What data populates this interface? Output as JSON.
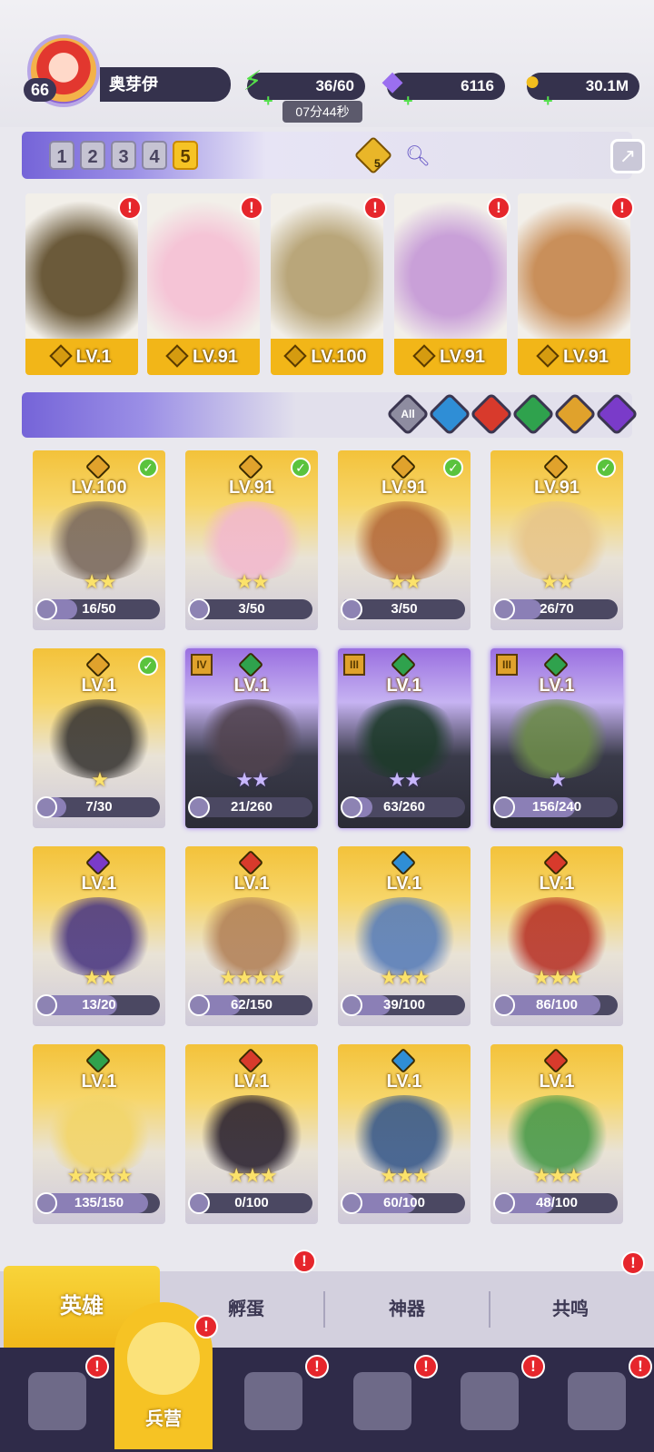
{
  "player": {
    "level": "66",
    "name": "奥芽伊"
  },
  "resources": {
    "energy": {
      "value": "36/60",
      "timer": "07分44秒",
      "icon": "lightning-icon"
    },
    "gems": {
      "value": "6116",
      "icon": "gem-icon"
    },
    "gold": {
      "value": "30.1M",
      "icon": "coin-icon"
    }
  },
  "team": {
    "slots": [
      "1",
      "2",
      "3",
      "4",
      "5"
    ],
    "active_slot": "5",
    "diamond_count": "5"
  },
  "lineup": [
    {
      "level": "LV.1",
      "color": "#6b5a3a"
    },
    {
      "level": "LV.91",
      "color": "#f5c4d6"
    },
    {
      "level": "LV.100",
      "color": "#b9a67a"
    },
    {
      "level": "LV.91",
      "color": "#c9a0d8"
    },
    {
      "level": "LV.91",
      "color": "#c98f5a"
    }
  ],
  "filters": [
    {
      "label": "All",
      "color": "#8e8ca0"
    },
    {
      "label": "",
      "color": "#2f8ed6"
    },
    {
      "label": "",
      "color": "#d83a2c"
    },
    {
      "label": "",
      "color": "#2fa24d"
    },
    {
      "label": "",
      "color": "#e0a22c"
    },
    {
      "label": "",
      "color": "#7a3bc9"
    }
  ],
  "heroes": [
    {
      "level": "LV.100",
      "progress": "16/50",
      "fraction": 0.32,
      "stars": "★★",
      "element": "#e0a22c",
      "owned": true,
      "rank": "",
      "purple": false,
      "art": "#7b6a5e"
    },
    {
      "level": "LV.91",
      "progress": "3/50",
      "fraction": 0.06,
      "stars": "★★",
      "element": "#e0a22c",
      "owned": true,
      "rank": "",
      "purple": false,
      "art": "#f2b9cd"
    },
    {
      "level": "LV.91",
      "progress": "3/50",
      "fraction": 0.06,
      "stars": "★★",
      "element": "#e0a22c",
      "owned": true,
      "rank": "",
      "purple": false,
      "art": "#b56b3a"
    },
    {
      "level": "LV.91",
      "progress": "26/70",
      "fraction": 0.37,
      "stars": "★★",
      "element": "#e0a22c",
      "owned": true,
      "rank": "",
      "purple": false,
      "art": "#e7c58a"
    },
    {
      "level": "LV.1",
      "progress": "7/30",
      "fraction": 0.23,
      "stars": "★",
      "element": "#e0a22c",
      "owned": true,
      "rank": "",
      "purple": false,
      "art": "#3b3835"
    },
    {
      "level": "LV.1",
      "progress": "21/260",
      "fraction": 0.08,
      "stars": "★★",
      "element": "#2fa24d",
      "owned": false,
      "rank": "IV",
      "purple": true,
      "art": "#51434f"
    },
    {
      "level": "LV.1",
      "progress": "63/260",
      "fraction": 0.24,
      "stars": "★★",
      "element": "#2fa24d",
      "owned": false,
      "rank": "III",
      "purple": true,
      "art": "#1d3a2a"
    },
    {
      "level": "LV.1",
      "progress": "156/240",
      "fraction": 0.65,
      "stars": "★",
      "element": "#2fa24d",
      "owned": false,
      "rank": "III",
      "purple": true,
      "art": "#6c8a4a"
    },
    {
      "level": "LV.1",
      "progress": "13/20",
      "fraction": 0.65,
      "stars": "★★",
      "element": "#7a3bc9",
      "owned": false,
      "rank": "",
      "purple": false,
      "art": "#4d3a82"
    },
    {
      "level": "LV.1",
      "progress": "62/150",
      "fraction": 0.41,
      "stars": "★★★★",
      "element": "#d83a2c",
      "owned": false,
      "rank": "",
      "purple": false,
      "art": "#b3835a"
    },
    {
      "level": "LV.1",
      "progress": "39/100",
      "fraction": 0.39,
      "stars": "★★★",
      "element": "#2f8ed6",
      "owned": false,
      "rank": "",
      "purple": false,
      "art": "#5a7eb8"
    },
    {
      "level": "LV.1",
      "progress": "86/100",
      "fraction": 0.86,
      "stars": "★★★",
      "element": "#d83a2c",
      "owned": false,
      "rank": "",
      "purple": false,
      "art": "#b8362a"
    },
    {
      "level": "LV.1",
      "progress": "135/150",
      "fraction": 0.9,
      "stars": "★★★★",
      "element": "#2fa24d",
      "owned": false,
      "rank": "",
      "purple": false,
      "art": "#f2d56a"
    },
    {
      "level": "LV.1",
      "progress": "0/100",
      "fraction": 0.0,
      "stars": "★★★",
      "element": "#d83a2c",
      "owned": false,
      "rank": "",
      "purple": false,
      "art": "#2d2431"
    },
    {
      "level": "LV.1",
      "progress": "60/100",
      "fraction": 0.6,
      "stars": "★★★",
      "element": "#2f8ed6",
      "owned": false,
      "rank": "",
      "purple": false,
      "art": "#3a5a8a"
    },
    {
      "level": "LV.1",
      "progress": "48/100",
      "fraction": 0.48,
      "stars": "★★★",
      "element": "#d83a2c",
      "owned": false,
      "rank": "",
      "purple": false,
      "art": "#4a9a4a"
    }
  ],
  "tabs": {
    "hero": "英雄",
    "hatch": "孵蛋",
    "artifact": "神器",
    "resonance": "共鸣"
  },
  "nav": {
    "barracks": "兵营"
  },
  "alert_mark": "!"
}
